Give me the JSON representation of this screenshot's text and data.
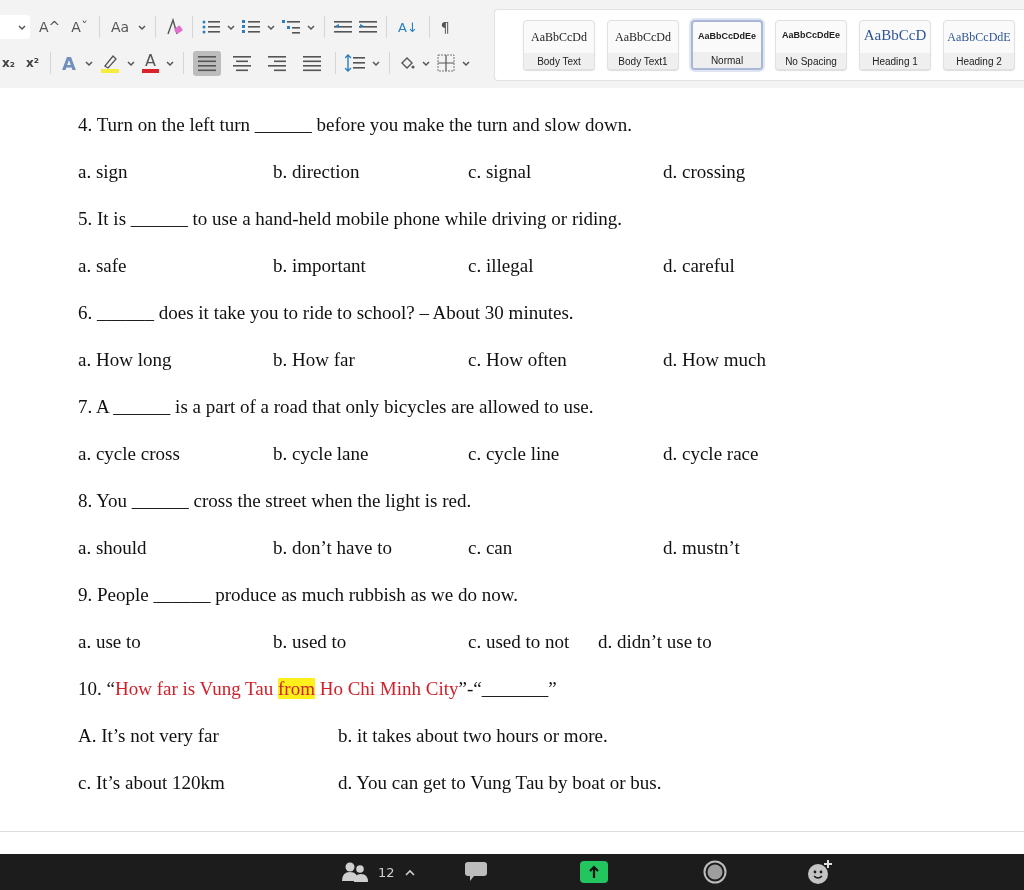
{
  "toolbar": {
    "grow_font": "A^",
    "shrink_font": "Aˇ",
    "change_case": "Aa",
    "subscript": "x₂",
    "superscript": "x²",
    "text_effects": "A",
    "font_color": "A",
    "sort": "A↓",
    "show_marks": "¶",
    "align_buttons": [
      {
        "selected": true
      },
      {
        "selected": false
      },
      {
        "selected": false
      },
      {
        "selected": false
      }
    ]
  },
  "styles": [
    {
      "preview": "AaBbCcDd",
      "label": "Body Text",
      "kind": "serif",
      "selected": false
    },
    {
      "preview": "AaBbCcDd",
      "label": "Body Text1",
      "kind": "serif",
      "selected": false
    },
    {
      "preview": "AaBbCcDdEe",
      "label": "Normal",
      "kind": "sans",
      "selected": true
    },
    {
      "preview": "AaBbCcDdEe",
      "label": "No Spacing",
      "kind": "sans",
      "selected": false
    },
    {
      "preview": "AaBbCcD",
      "label": "Heading 1",
      "kind": "heading",
      "selected": false
    },
    {
      "preview": "AaBbCcDdE",
      "label": "Heading 2",
      "kind": "heading2",
      "selected": false
    }
  ],
  "questions": [
    {
      "parts": [
        {
          "kind": "plain",
          "text": "4. Turn on the left turn ______ before you make the turn and slow down."
        }
      ],
      "kind": "four",
      "options": [
        "a. sign",
        "b. direction",
        "c. signal",
        "d. crossing"
      ]
    },
    {
      "parts": [
        {
          "kind": "plain",
          "text": "5. It is ______ to use a hand-held mobile phone while driving or riding."
        }
      ],
      "kind": "four",
      "options": [
        "a. safe",
        "b. important",
        "c. illegal",
        "d. careful"
      ]
    },
    {
      "parts": [
        {
          "kind": "plain",
          "text": "6. ______ does it take you to ride to school? – About 30 minutes."
        }
      ],
      "kind": "four",
      "options": [
        "a. How long",
        "b. How far",
        "c. How often",
        "d. How much"
      ]
    },
    {
      "parts": [
        {
          "kind": "plain",
          "text": "7. A ______ is a part of a road that only bicycles are allowed to use."
        }
      ],
      "kind": "four",
      "options": [
        "a. cycle cross",
        "b. cycle lane",
        "c. cycle line",
        "d. cycle race"
      ]
    },
    {
      "parts": [
        {
          "kind": "plain",
          "text": "8. You ______ cross the street when the light is red."
        }
      ],
      "kind": "four",
      "options": [
        "a. should",
        "b. don’t have to",
        "c. can",
        "d. mustn’t"
      ]
    },
    {
      "parts": [
        {
          "kind": "plain",
          "text": "9. People ______ produce as much rubbish as we do now."
        }
      ],
      "kind": "compact",
      "options": [
        "a. use to",
        "b. used to",
        "c. used to not",
        "d. didn’t use to"
      ]
    },
    {
      "parts": [
        {
          "kind": "plain",
          "text": "10. “"
        },
        {
          "kind": "red",
          "text": "How far is Vung Tau "
        },
        {
          "kind": "highlight",
          "text": "from"
        },
        {
          "kind": "red",
          "text": " Ho Chi Minh City"
        },
        {
          "kind": "plain",
          "text": "”-“_______”"
        }
      ],
      "kind": "two",
      "options": [
        "A. It’s not very far",
        "b. it takes about two hours or more.",
        "c. It’s about 120km",
        "d. You can get to Vung Tau by boat or bus."
      ]
    }
  ],
  "meeting_bar": {
    "participants": "12"
  }
}
